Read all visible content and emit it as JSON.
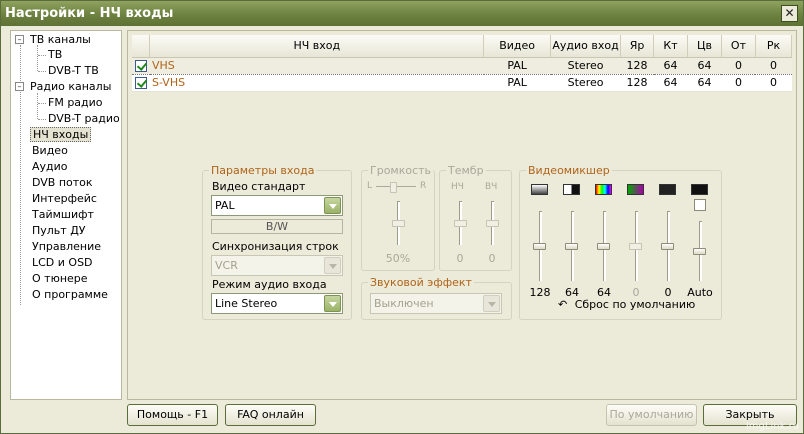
{
  "window": {
    "title": "Настройки - НЧ входы",
    "close": "✕"
  },
  "tree": {
    "items": [
      {
        "label": "ТВ каналы",
        "expander": "–"
      },
      {
        "label": "ТВ"
      },
      {
        "label": "DVB-T ТВ"
      },
      {
        "label": "Радио каналы",
        "expander": "–"
      },
      {
        "label": "FM радио"
      },
      {
        "label": "DVB-T радио"
      },
      {
        "label": "НЧ входы",
        "selected": true
      },
      {
        "label": "Видео"
      },
      {
        "label": "Аудио"
      },
      {
        "label": "DVB поток"
      },
      {
        "label": "Интерфейс"
      },
      {
        "label": "Таймшифт"
      },
      {
        "label": "Пульт ДУ"
      },
      {
        "label": "Управление"
      },
      {
        "label": "LCD и OSD"
      },
      {
        "label": "О тюнере"
      },
      {
        "label": "О программе"
      }
    ]
  },
  "table": {
    "headers": [
      "НЧ вход",
      "Видео",
      "Аудио вход",
      "Яр",
      "Кт",
      "Цв",
      "От",
      "Рк"
    ],
    "rows": [
      {
        "checked": true,
        "name": "VHS",
        "video": "PAL",
        "audio": "Stereo",
        "br": "128",
        "ct": "64",
        "cv": "64",
        "ot": "0",
        "rk": "0",
        "selected": true
      },
      {
        "checked": true,
        "name": "S-VHS",
        "video": "PAL",
        "audio": "Stereo",
        "br": "128",
        "ct": "64",
        "cv": "64",
        "ot": "0",
        "rk": "0"
      }
    ]
  },
  "input_params": {
    "title": "Параметры входа",
    "video_std_label": "Видео стандарт",
    "video_std_value": "PAL",
    "bw_label": "B/W",
    "sync_label": "Синхронизация строк",
    "sync_value": "VCR",
    "audio_mode_label": "Режим аудио входа",
    "audio_mode_value": "Line Stereo"
  },
  "volume": {
    "title": "Громкость",
    "left": "L",
    "right": "R",
    "value": "50%"
  },
  "timbre": {
    "title": "Тембр",
    "low_label": "НЧ",
    "high_label": "ВЧ",
    "low_value": "0",
    "high_value": "0"
  },
  "sound_effect": {
    "title": "Звуковой эффект",
    "value": "Выключен"
  },
  "mixer": {
    "title": "Видеомикшер",
    "channels": [
      {
        "icon": "brightness-icon",
        "value": "128",
        "level": 0.5,
        "enabled": true
      },
      {
        "icon": "contrast-icon",
        "value": "64",
        "level": 0.5,
        "enabled": true
      },
      {
        "icon": "saturation-icon",
        "value": "64",
        "level": 0.5,
        "enabled": true
      },
      {
        "icon": "hue-icon",
        "value": "0",
        "level": 0.5,
        "enabled": false
      },
      {
        "icon": "sharpness-icon",
        "value": "0",
        "level": 0.5,
        "enabled": true
      },
      {
        "icon": "auto-icon",
        "value": "Auto",
        "level": 0.5,
        "enabled": true
      }
    ],
    "reset_label": "Сброс по умолчанию"
  },
  "footer": {
    "help": "Помощь - F1",
    "faq": "FAQ онлайн",
    "defaults": "По умолчанию",
    "close": "Закрыть"
  },
  "watermark": "ImgLink.ru",
  "colors": {
    "accent": "#b0641a",
    "titlebar": "#6d8140"
  }
}
